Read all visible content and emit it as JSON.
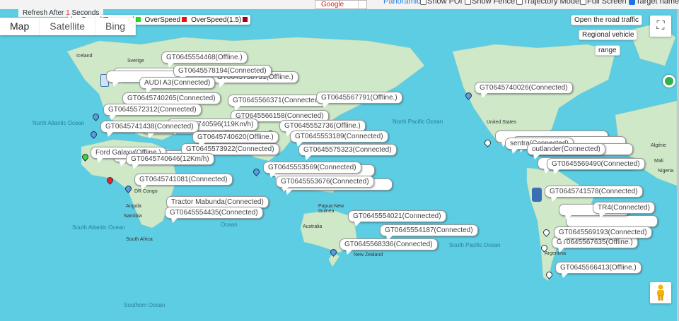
{
  "toolbar": {
    "map_provider": "Google",
    "panoramic": "Panoramic",
    "checkboxes": [
      {
        "label": "Show POI",
        "checked": false
      },
      {
        "label": "Show Fence",
        "checked": false
      },
      {
        "label": "Trajectory Model",
        "checked": false
      },
      {
        "label": "Full Screen",
        "checked": false
      },
      {
        "label": "Target name",
        "checked": true
      }
    ]
  },
  "refresh": {
    "prefix": "Refresh After",
    "seconds": "1",
    "suffix": "Seconds"
  },
  "legend": [
    {
      "label": "lowSpeed",
      "color": "#2f5f9e"
    },
    {
      "label": "normal",
      "color": "#22dd22"
    },
    {
      "label": "OverSpeed",
      "color": "#ee1111"
    },
    {
      "label": "OverSpeed(1.5)",
      "color": "#a0001c"
    }
  ],
  "map_types": [
    "Map",
    "Satellite",
    "Bing"
  ],
  "map_controls": {
    "road_traffic": "Open the road traffic",
    "regional_vehicle": "Regional vehicle",
    "range": "range"
  },
  "ocean_labels": [
    "North Atlantic Ocean",
    "South Atlantic Ocean",
    "North Pacific Ocean",
    "South Pacific Ocean",
    "Southern Ocean",
    "Ocean"
  ],
  "country_labels": [
    "Iceland",
    "Sverige",
    "United States",
    "Australia",
    "Angola",
    "Namibia",
    "South Africa",
    "Argentina",
    "Papua New Guinea",
    "Algérie",
    "Mali",
    "Nigeria",
    "New Zealand",
    "DR Congo"
  ],
  "vehicle_labels": [
    "GT0645554468(Offline.)",
    "GT0645578194(Connected)",
    "GT0645738731(Offline.)",
    "AUDI A3(Connected)",
    "GT0645740265(Connected)",
    "GT0645572312(Connected)",
    "GT0645566371(Connected)",
    "GT0645567791(Offline.)",
    "GT0645741438(Connected)",
    "GT0645740596(119Km/h)",
    "GT0645573922(Connected)",
    "GT0645552736(Offline.)",
    "GT0645553189(Connected)",
    "GT0645575323(Connected)",
    "Ford Galaxy(Offline.)",
    "GT0645740646(12Km/h)",
    "GT0645741081(Connected)",
    "GT0645553569(Connected)",
    "GT0645553676(Connected)",
    "Tractor Mabunda(Connected)",
    "GT0645554435(Connected)",
    "GT0645740026(Connected)",
    "sentra(Connected)",
    "outlander(Connected)",
    "GT0645569490(Connected)",
    "GT0645741578(Connected)",
    "TR4(Connected)",
    "GT0645569193(Connected)",
    "GT0645567635(Offline.)",
    "GT0645566413(Offline.)",
    "GT0645554021(Connected)",
    "GT0645554187(Connected)",
    "GT0645568336(Connected)",
    "GT0645566158(Connected)",
    "GT0645740620(Offline.)"
  ]
}
